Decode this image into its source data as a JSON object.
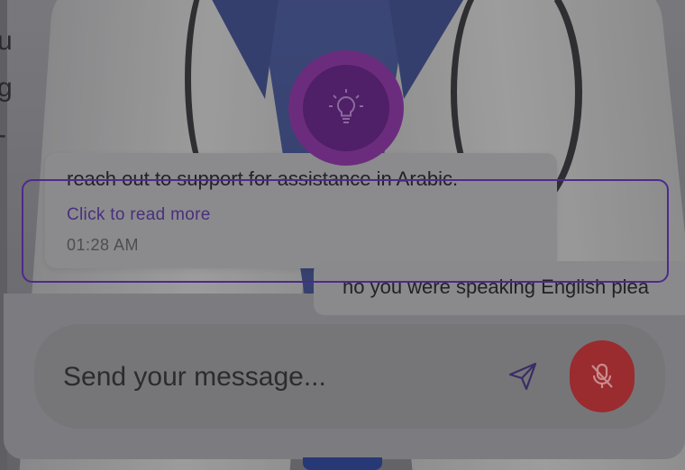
{
  "chat": {
    "bot_message": {
      "text": "reach out to support for assistance in Arabic.",
      "read_more": "Click to read more",
      "time": "01:28 AM"
    },
    "user_message": {
      "text": "no you were speaking English plea"
    }
  },
  "composer": {
    "placeholder": "Send your message..."
  },
  "background": {
    "left_edge_glyphs": "u\ng\n-"
  },
  "icons": {
    "tip": "lightbulb-icon",
    "send": "send-icon",
    "mic": "mic-off-icon"
  },
  "colors": {
    "accent": "#6c2c7e",
    "mic_button": "#9a2b2f",
    "link": "#4a2e7d"
  }
}
